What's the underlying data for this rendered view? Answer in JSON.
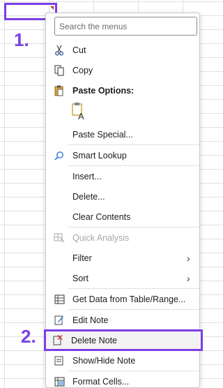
{
  "step_labels": {
    "one": "1.",
    "two": "2."
  },
  "search": {
    "placeholder": "Search the menus"
  },
  "menu": {
    "cut": "Cut",
    "copy": "Copy",
    "paste_options": "Paste Options:",
    "paste_special": "Paste Special...",
    "smart_lookup": "Smart Lookup",
    "insert": "Insert...",
    "delete": "Delete...",
    "clear_contents": "Clear Contents",
    "quick_analysis": "Quick Analysis",
    "filter": "Filter",
    "sort": "Sort",
    "get_data": "Get Data from Table/Range...",
    "edit_note": "Edit Note",
    "delete_note": "Delete Note",
    "show_hide_note": "Show/Hide Note",
    "format_cells": "Format Cells..."
  },
  "colors": {
    "highlight": "#7b3fe4"
  }
}
